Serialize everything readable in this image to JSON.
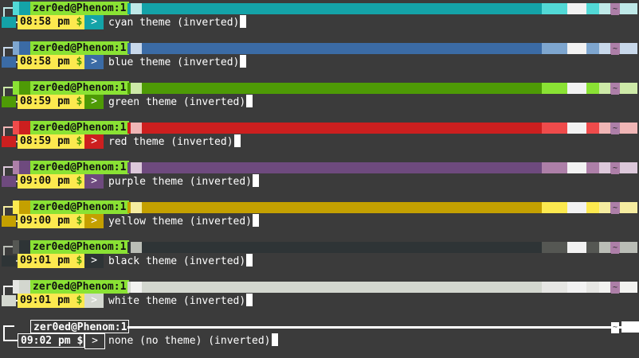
{
  "prompt": {
    "host": "zer0ed@Phenom:1",
    "dollar": "$",
    "arrow": ">",
    "tilde": "~"
  },
  "themes": [
    {
      "time": "08:58 pm",
      "command": "cyan theme (inverted)",
      "main": "#14a3a8",
      "light": "#52d9d6",
      "pale": "#bfe9e8",
      "accent": "#9fe8e6"
    },
    {
      "time": "08:58 pm",
      "command": "blue theme (inverted)",
      "main": "#3b6ba5",
      "light": "#7ea6cf",
      "pale": "#c8d8ea",
      "accent": "#a9c4e0"
    },
    {
      "time": "08:59 pm",
      "command": "green theme (inverted)",
      "main": "#4e9a06",
      "light": "#8ae234",
      "pale": "#cde9a8",
      "accent": "#b5e27a"
    },
    {
      "time": "08:59 pm",
      "command": "red theme (inverted)",
      "main": "#cc1f1f",
      "light": "#ef4b4b",
      "pale": "#f0b6b6",
      "accent": "#f36f6f"
    },
    {
      "time": "09:00 pm",
      "command": "purple theme (inverted)",
      "main": "#6e4a7e",
      "light": "#ad7fa8",
      "pale": "#dcc8da",
      "accent": "#c8a8c4"
    },
    {
      "time": "09:00 pm",
      "command": "yellow theme (inverted)",
      "main": "#c4a000",
      "light": "#fce94f",
      "pale": "#f5eca0",
      "accent": "#edd400"
    },
    {
      "time": "09:01 pm",
      "command": "black theme (inverted)",
      "main": "#2e3436",
      "light": "#555753",
      "pale": "#babdb6",
      "accent": "#888a85"
    },
    {
      "time": "09:01 pm",
      "command": "white theme (inverted)",
      "main": "#d3d7cf",
      "light": "#e6e6e3",
      "pale": "#f2f2f0",
      "accent": "#eeeeec"
    },
    {
      "time": "09:02 pm",
      "command": "none (no theme) (inverted)",
      "main": "#ffffff",
      "light": "#ffffff",
      "pale": "#ffffff",
      "accent": "#ffffff"
    }
  ]
}
